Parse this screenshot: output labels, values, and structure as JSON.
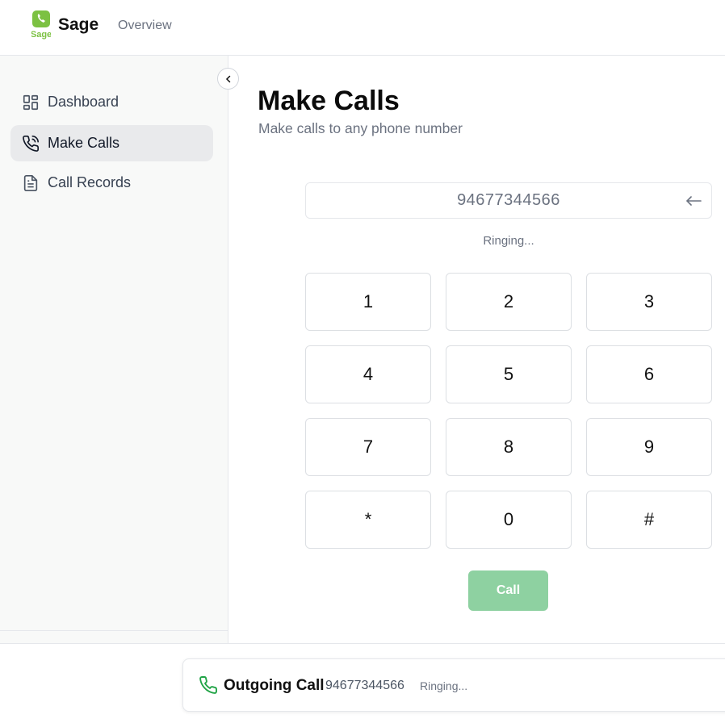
{
  "app": {
    "brand": "Sage",
    "logo_text": "Sage",
    "nav_link": "Overview"
  },
  "sidebar": {
    "items": [
      {
        "label": "Dashboard",
        "icon": "dashboard-icon",
        "active": false
      },
      {
        "label": "Make Calls",
        "icon": "phone-call-icon",
        "active": true
      },
      {
        "label": "Call Records",
        "icon": "document-icon",
        "active": false
      }
    ]
  },
  "page": {
    "title": "Make Calls",
    "subtitle": "Make calls to any phone number"
  },
  "dialer": {
    "number": "94677344566",
    "status": "Ringing...",
    "keys": [
      "1",
      "2",
      "3",
      "4",
      "5",
      "6",
      "7",
      "8",
      "9",
      "*",
      "0",
      "#"
    ],
    "call_label": "Call"
  },
  "call_banner": {
    "title": "Outgoing Call",
    "number": "94677344566",
    "status": "Ringing..."
  },
  "colors": {
    "brand_green": "#7cc142",
    "call_green": "#22a447",
    "call_button": "#8ed1a1"
  }
}
